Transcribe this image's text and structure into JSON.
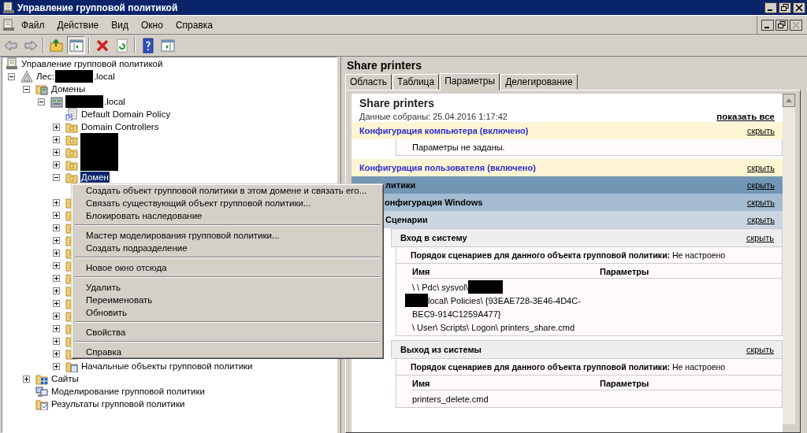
{
  "window": {
    "title": "Управление групповой политикой"
  },
  "menu_bar": [
    "Файл",
    "Действие",
    "Вид",
    "Окно",
    "Справка"
  ],
  "toolbar": [
    {
      "kind": "back",
      "pressed": false
    },
    {
      "kind": "forward",
      "pressed": false
    },
    {
      "kind": "sep"
    },
    {
      "kind": "up",
      "pressed": false
    },
    {
      "kind": "tree",
      "pressed": true
    },
    {
      "kind": "sep"
    },
    {
      "kind": "delete",
      "pressed": false
    },
    {
      "kind": "refresh",
      "pressed": false
    },
    {
      "kind": "sep"
    },
    {
      "kind": "help",
      "pressed": false
    },
    {
      "kind": "pane",
      "pressed": false
    }
  ],
  "tree": [
    {
      "kind": "root",
      "label": "Управление групповой политикой",
      "selected": false,
      "children": [
        {
          "kind": "forest",
          "parts": [
            {
              "kind": "text",
              "text": "Лес:"
            },
            {
              "kind": "redacted"
            },
            {
              "kind": "text",
              "text": ".local"
            }
          ],
          "expanded": true,
          "selected": false,
          "children": [
            {
              "kind": "domains",
              "label": "Домены",
              "expanded": true,
              "selected": false,
              "children": [
                {
                  "kind": "domain",
                  "parts": [
                    {
                      "kind": "redacted"
                    },
                    {
                      "kind": "text",
                      "text": ".local"
                    }
                  ],
                  "expanded": true,
                  "selected": false,
                  "children": [
                    {
                      "kind": "gpo-link",
                      "label": "Default Domain Policy",
                      "selected": false
                    },
                    {
                      "kind": "folder",
                      "label": "Domain Controllers",
                      "expanded": false,
                      "selected": false
                    },
                    {
                      "kind": "folder",
                      "parts": [
                        {
                          "kind": "redacted"
                        }
                      ],
                      "expanded": false,
                      "selected": false
                    },
                    {
                      "kind": "folder",
                      "parts": [
                        {
                          "kind": "redacted"
                        }
                      ],
                      "expanded": false,
                      "selected": false
                    },
                    {
                      "kind": "folder",
                      "parts": [
                        {
                          "kind": "redacted"
                        }
                      ],
                      "expanded": false,
                      "selected": false
                    },
                    {
                      "kind": "folder",
                      "label": "Домен",
                      "expanded": true,
                      "selected": true
                    },
                    {
                      "kind": "folder",
                      "expanded": false,
                      "selected": false
                    },
                    {
                      "kind": "folder",
                      "expanded": false,
                      "selected": false
                    },
                    {
                      "kind": "folder",
                      "expanded": false,
                      "selected": false
                    },
                    {
                      "kind": "folder",
                      "expanded": false,
                      "selected": false
                    },
                    {
                      "kind": "folder",
                      "expanded": false,
                      "selected": false
                    },
                    {
                      "kind": "folder",
                      "expanded": false,
                      "selected": false
                    },
                    {
                      "kind": "folder",
                      "expanded": false,
                      "selected": false
                    },
                    {
                      "kind": "folder",
                      "expanded": false,
                      "selected": false
                    },
                    {
                      "kind": "folder",
                      "expanded": false,
                      "selected": false
                    },
                    {
                      "kind": "folder",
                      "expanded": false,
                      "selected": false
                    },
                    {
                      "kind": "folder",
                      "expanded": false,
                      "selected": false
                    },
                    {
                      "kind": "folder",
                      "expanded": false,
                      "selected": false
                    },
                    {
                      "kind": "folder",
                      "expanded": false,
                      "selected": false
                    },
                    {
                      "kind": "starter",
                      "label": "Начальные объекты групповой политики",
                      "expanded": false,
                      "selected": false
                    }
                  ]
                }
              ]
            },
            {
              "kind": "sites",
              "label": "Сайты",
              "expanded": false,
              "selected": false
            },
            {
              "kind": "modeling",
              "label": "Моделирование групповой политики",
              "selected": false
            },
            {
              "kind": "results",
              "label": "Результаты групповой политики",
              "selected": false
            }
          ]
        }
      ]
    }
  ],
  "context_menu": [
    {
      "kind": "item",
      "label": "Создать объект групповой политики в этом домене и связать его..."
    },
    {
      "kind": "item",
      "label": "Связать существующий объект групповой политики..."
    },
    {
      "kind": "item",
      "label": "Блокировать наследование"
    },
    {
      "kind": "separator"
    },
    {
      "kind": "item",
      "label": "Мастер моделирования групповой политики..."
    },
    {
      "kind": "item",
      "label": "Создать подразделение"
    },
    {
      "kind": "separator"
    },
    {
      "kind": "item",
      "label": "Новое окно отсюда"
    },
    {
      "kind": "separator"
    },
    {
      "kind": "item",
      "label": "Удалить"
    },
    {
      "kind": "item",
      "label": "Переименовать"
    },
    {
      "kind": "item",
      "label": "Обновить"
    },
    {
      "kind": "separator"
    },
    {
      "kind": "item",
      "label": "Свойства"
    },
    {
      "kind": "separator"
    },
    {
      "kind": "item",
      "label": "Справка"
    }
  ],
  "details": {
    "title": "Share printers",
    "tabs": [
      {
        "label": "Область",
        "selected": false
      },
      {
        "label": "Таблица",
        "selected": false
      },
      {
        "label": "Параметры",
        "selected": true
      },
      {
        "label": "Делегирование",
        "selected": false
      }
    ],
    "report": {
      "title": "Share printers",
      "collected": "Данные собраны: 25.04.2016 1:17:42",
      "show_all": "показать все",
      "sections": [
        {
          "kind": "config",
          "title": "Конфигурация компьютера (включено)",
          "hide": "скрыть",
          "children": [
            {
              "kind": "note",
              "text": "Параметры не заданы."
            }
          ]
        },
        {
          "kind": "config",
          "title": "Конфигурация пользователя (включено)",
          "hide": "скрыть",
          "children": [
            {
              "kind": "level1",
              "title": "литики",
              "hide": "скрыть",
              "children": [
                {
                  "kind": "level2",
                  "title": "онфигурация Windows",
                  "hide": "скрыть",
                  "children": [
                    {
                      "kind": "level3",
                      "title": "Сценарии",
                      "hide": "скрыть",
                      "children": [
                        {
                          "kind": "level4",
                          "title": "Вход в систему",
                          "hide": "скрыть",
                          "children": [
                            {
                              "kind": "order",
                              "label": "Порядок сценариев для данного объекта групповой политики:",
                              "value": "Не настроено"
                            },
                            {
                              "kind": "table",
                              "columns": [
                                "Имя",
                                "Параметры"
                              ],
                              "rows": [
                                [
                                  {
                                    "lines": [
                                      [
                                        {
                                          "kind": "text",
                                          "text": "\\ \\ Pdc\\ sysvol\\"
                                        },
                                        {
                                          "kind": "redacted"
                                        }
                                      ],
                                      [
                                        {
                                          "kind": "redacted"
                                        },
                                        {
                                          "kind": "text",
                                          "text": "local\\ Policies\\ {93EAE728-3E46-4D4C-"
                                        }
                                      ],
                                      [
                                        {
                                          "kind": "text",
                                          "text": "BEC9-914C1259A477}"
                                        }
                                      ],
                                      [
                                        {
                                          "kind": "text",
                                          "text": "\\ User\\ Scripts\\ Logon\\ printers_share.cmd"
                                        }
                                      ]
                                    ]
                                  }
                                ]
                              ]
                            }
                          ]
                        },
                        {
                          "kind": "level4",
                          "title": "Выход из системы",
                          "hide": "скрыть",
                          "children": [
                            {
                              "kind": "order",
                              "label": "Порядок сценариев для данного объекта групповой политики:",
                              "value": "Не настроено"
                            },
                            {
                              "kind": "table",
                              "columns": [
                                "Имя",
                                "Параметры"
                              ],
                              "rows": [
                                [
                                  {
                                    "lines": [
                                      [
                                        {
                                          "kind": "text",
                                          "text": "printers_delete.cmd"
                                        }
                                      ]
                                    ]
                                  }
                                ]
                              ]
                            }
                          ]
                        }
                      ]
                    }
                  ]
                }
              ]
            }
          ]
        }
      ]
    }
  }
}
